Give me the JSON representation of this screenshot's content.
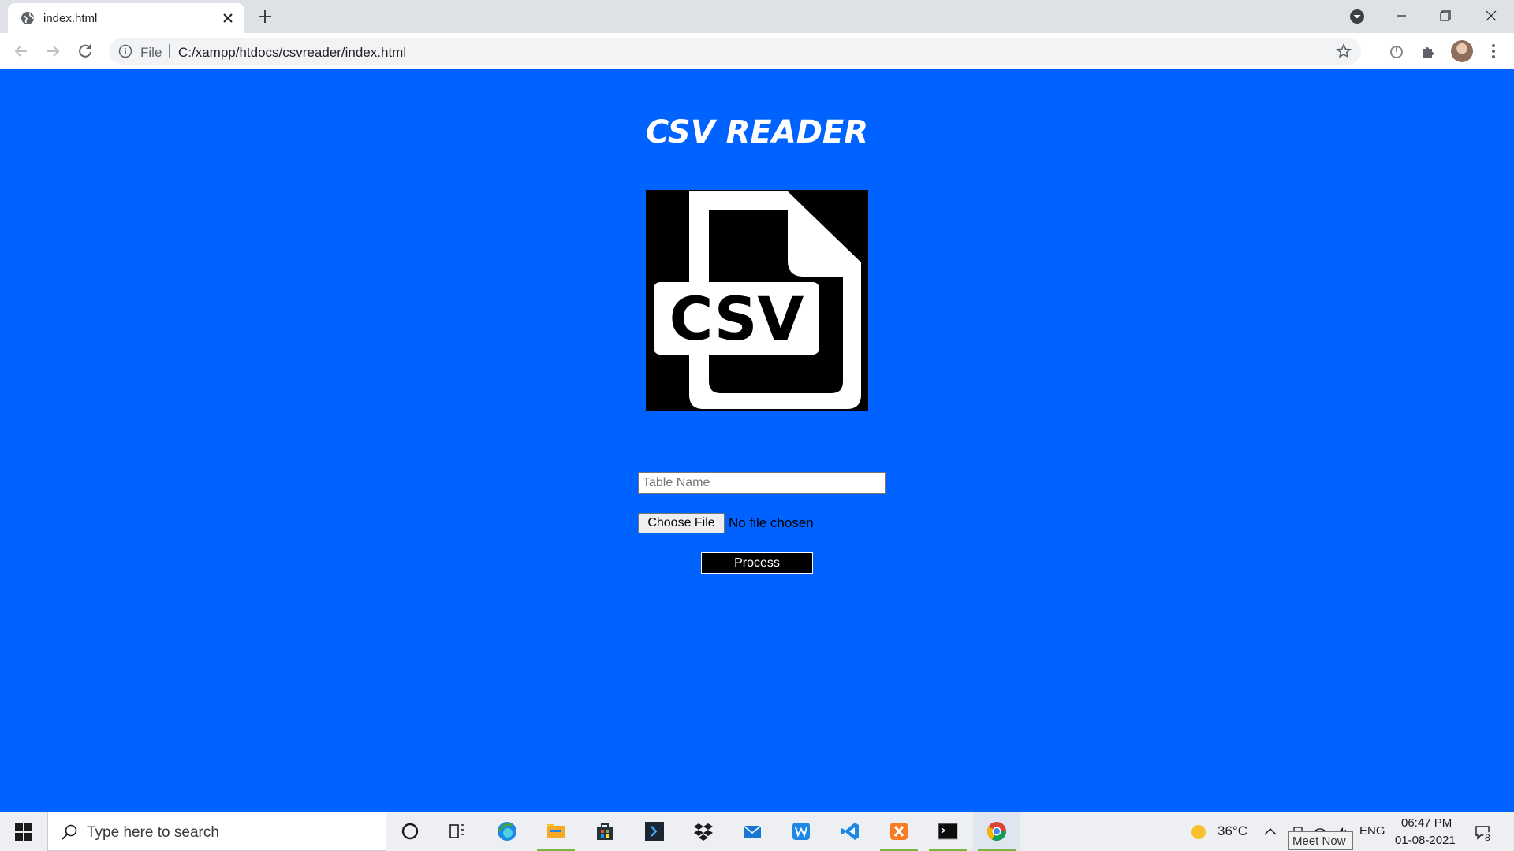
{
  "browser": {
    "tab_title": "index.html",
    "address_scheme": "File",
    "address_url": "C:/xampp/htdocs/csvreader/index.html"
  },
  "page": {
    "title": "CSV READER",
    "logo_text": "CSV",
    "table_name_placeholder": "Table Name",
    "table_name_value": "",
    "choose_file_label": "Choose File",
    "no_file_text": "No file chosen",
    "process_label": "Process"
  },
  "taskbar": {
    "search_placeholder": "Type here to search",
    "apps": [
      "cortana-icon",
      "task-view-icon",
      "edge-icon",
      "file-explorer-icon",
      "store-icon",
      "powershell-icon",
      "dropbox-icon",
      "mail-icon",
      "wps-writer-icon",
      "vscode-icon",
      "xampp-icon",
      "terminal-icon",
      "chrome-icon"
    ],
    "weather": "36°C",
    "language": "ENG",
    "time": "06:47 PM",
    "date": "01-08-2021",
    "notification_count": "8",
    "tooltip": "Meet Now"
  },
  "colors": {
    "page_background": "#0062FF",
    "tabbar": "#DEE1E6",
    "taskbar": "#EDEFF2",
    "process_button": "#000000"
  }
}
